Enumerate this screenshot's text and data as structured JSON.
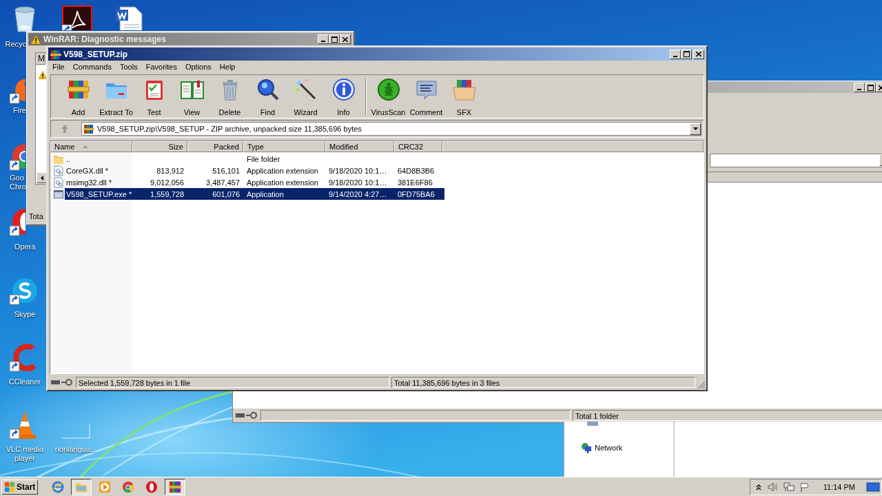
{
  "desktop": {
    "icons": [
      {
        "kind": "recycle",
        "label": "Recyc",
        "shortcut": false
      },
      {
        "kind": "acrobat",
        "shortcut": true
      },
      {
        "kind": "word",
        "shortcut": false
      },
      {
        "kind": "firefox",
        "label": "Fire",
        "shortcut": true
      },
      {
        "kind": "chrome",
        "label": "Goo Chro",
        "shortcut": true
      },
      {
        "kind": "opera",
        "label": "Opera",
        "shortcut": true
      },
      {
        "kind": "skype",
        "label": "Skype",
        "shortcut": true
      },
      {
        "kind": "ccleaner",
        "label": "CCleaner",
        "shortcut": true
      },
      {
        "kind": "vlc",
        "label": "VLC media player",
        "shortcut": true
      },
      {
        "kind": "blank",
        "label": "nonlangua...",
        "shortcut": false
      }
    ]
  },
  "background_window": {
    "status": "Total 1 folder"
  },
  "explorer_window": {
    "nav_items": [
      {
        "label": "Network"
      }
    ]
  },
  "diagnostic_window": {
    "title": "WinRAR: Diagnostic messages",
    "column_1": "M",
    "status": "Tota"
  },
  "winrar": {
    "title": "V598_SETUP.zip",
    "menu": [
      "File",
      "Commands",
      "Tools",
      "Favorites",
      "Options",
      "Help"
    ],
    "toolbar_groups": [
      {
        "buttons": [
          {
            "label": "Add",
            "kind": "add"
          },
          {
            "label": "Extract To",
            "kind": "extract"
          },
          {
            "label": "Test",
            "kind": "test"
          },
          {
            "label": "View",
            "kind": "view"
          },
          {
            "label": "Delete",
            "kind": "delete"
          },
          {
            "label": "Find",
            "kind": "find"
          },
          {
            "label": "Wizard",
            "kind": "wizard"
          },
          {
            "label": "Info",
            "kind": "info"
          }
        ]
      },
      {
        "buttons": [
          {
            "label": "VirusScan",
            "kind": "virusscan"
          },
          {
            "label": "Comment",
            "kind": "comment"
          },
          {
            "label": "SFX",
            "kind": "sfx"
          }
        ]
      }
    ],
    "path": "V598_SETUP.zip\\V598_SETUP - ZIP archive, unpacked size 11,385,696 bytes",
    "columns": [
      {
        "label": "Name",
        "sorted": true
      },
      {
        "label": "Size",
        "sorted": false
      },
      {
        "label": "Packed",
        "sorted": false
      },
      {
        "label": "Type",
        "sorted": false
      },
      {
        "label": "Modified",
        "sorted": false
      },
      {
        "label": "CRC32",
        "sorted": false
      }
    ],
    "rows": [
      {
        "name": "..",
        "type": "File folder",
        "kind": "folder",
        "selected": false
      },
      {
        "name": "CoreGX.dll *",
        "size": "813,912",
        "packed": "516,101",
        "type": "Application extension",
        "modified": "9/18/2020 10:1…",
        "crc32": "64D8B3B6",
        "kind": "dll",
        "selected": false
      },
      {
        "name": "msimg32.dll *",
        "size": "9,012,056",
        "packed": "3,487,457",
        "type": "Application extension",
        "modified": "9/18/2020 10:1…",
        "crc32": "381E6F86",
        "kind": "dll",
        "selected": false
      },
      {
        "name": "V598_SETUP.exe *",
        "size": "1,559,728",
        "packed": "601,076",
        "type": "Application",
        "modified": "9/14/2020 4:27…",
        "crc32": "0FD75BA6",
        "kind": "exe",
        "selected": true
      }
    ],
    "status_left": "Selected 1,559,728 bytes in 1 file",
    "status_right": "Total 11,385,696 bytes in 3 files"
  },
  "taskbar": {
    "start": "Start",
    "apps": [
      {
        "kind": "ie",
        "pressed": false
      },
      {
        "kind": "explorer",
        "pressed": true
      },
      {
        "kind": "media",
        "pressed": false
      },
      {
        "kind": "chrome",
        "pressed": false
      },
      {
        "kind": "opera",
        "pressed": false
      },
      {
        "kind": "winrar",
        "pressed": true
      }
    ],
    "clock": "11:14 PM"
  }
}
